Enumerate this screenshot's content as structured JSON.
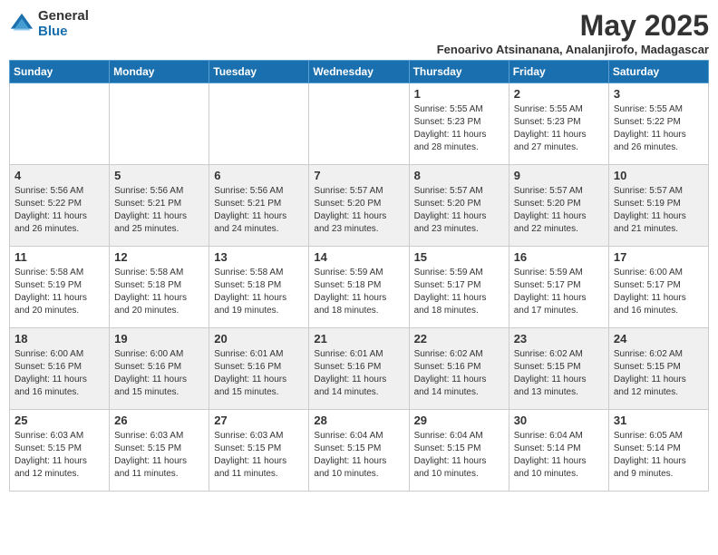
{
  "header": {
    "logo_general": "General",
    "logo_blue": "Blue",
    "month_title": "May 2025",
    "location": "Fenoarivo Atsinanana, Analanjirofo, Madagascar"
  },
  "days_of_week": [
    "Sunday",
    "Monday",
    "Tuesday",
    "Wednesday",
    "Thursday",
    "Friday",
    "Saturday"
  ],
  "weeks": [
    [
      {
        "day": "",
        "info": ""
      },
      {
        "day": "",
        "info": ""
      },
      {
        "day": "",
        "info": ""
      },
      {
        "day": "",
        "info": ""
      },
      {
        "day": "1",
        "info": "Sunrise: 5:55 AM\nSunset: 5:23 PM\nDaylight: 11 hours\nand 28 minutes."
      },
      {
        "day": "2",
        "info": "Sunrise: 5:55 AM\nSunset: 5:23 PM\nDaylight: 11 hours\nand 27 minutes."
      },
      {
        "day": "3",
        "info": "Sunrise: 5:55 AM\nSunset: 5:22 PM\nDaylight: 11 hours\nand 26 minutes."
      }
    ],
    [
      {
        "day": "4",
        "info": "Sunrise: 5:56 AM\nSunset: 5:22 PM\nDaylight: 11 hours\nand 26 minutes."
      },
      {
        "day": "5",
        "info": "Sunrise: 5:56 AM\nSunset: 5:21 PM\nDaylight: 11 hours\nand 25 minutes."
      },
      {
        "day": "6",
        "info": "Sunrise: 5:56 AM\nSunset: 5:21 PM\nDaylight: 11 hours\nand 24 minutes."
      },
      {
        "day": "7",
        "info": "Sunrise: 5:57 AM\nSunset: 5:20 PM\nDaylight: 11 hours\nand 23 minutes."
      },
      {
        "day": "8",
        "info": "Sunrise: 5:57 AM\nSunset: 5:20 PM\nDaylight: 11 hours\nand 23 minutes."
      },
      {
        "day": "9",
        "info": "Sunrise: 5:57 AM\nSunset: 5:20 PM\nDaylight: 11 hours\nand 22 minutes."
      },
      {
        "day": "10",
        "info": "Sunrise: 5:57 AM\nSunset: 5:19 PM\nDaylight: 11 hours\nand 21 minutes."
      }
    ],
    [
      {
        "day": "11",
        "info": "Sunrise: 5:58 AM\nSunset: 5:19 PM\nDaylight: 11 hours\nand 20 minutes."
      },
      {
        "day": "12",
        "info": "Sunrise: 5:58 AM\nSunset: 5:18 PM\nDaylight: 11 hours\nand 20 minutes."
      },
      {
        "day": "13",
        "info": "Sunrise: 5:58 AM\nSunset: 5:18 PM\nDaylight: 11 hours\nand 19 minutes."
      },
      {
        "day": "14",
        "info": "Sunrise: 5:59 AM\nSunset: 5:18 PM\nDaylight: 11 hours\nand 18 minutes."
      },
      {
        "day": "15",
        "info": "Sunrise: 5:59 AM\nSunset: 5:17 PM\nDaylight: 11 hours\nand 18 minutes."
      },
      {
        "day": "16",
        "info": "Sunrise: 5:59 AM\nSunset: 5:17 PM\nDaylight: 11 hours\nand 17 minutes."
      },
      {
        "day": "17",
        "info": "Sunrise: 6:00 AM\nSunset: 5:17 PM\nDaylight: 11 hours\nand 16 minutes."
      }
    ],
    [
      {
        "day": "18",
        "info": "Sunrise: 6:00 AM\nSunset: 5:16 PM\nDaylight: 11 hours\nand 16 minutes."
      },
      {
        "day": "19",
        "info": "Sunrise: 6:00 AM\nSunset: 5:16 PM\nDaylight: 11 hours\nand 15 minutes."
      },
      {
        "day": "20",
        "info": "Sunrise: 6:01 AM\nSunset: 5:16 PM\nDaylight: 11 hours\nand 15 minutes."
      },
      {
        "day": "21",
        "info": "Sunrise: 6:01 AM\nSunset: 5:16 PM\nDaylight: 11 hours\nand 14 minutes."
      },
      {
        "day": "22",
        "info": "Sunrise: 6:02 AM\nSunset: 5:16 PM\nDaylight: 11 hours\nand 14 minutes."
      },
      {
        "day": "23",
        "info": "Sunrise: 6:02 AM\nSunset: 5:15 PM\nDaylight: 11 hours\nand 13 minutes."
      },
      {
        "day": "24",
        "info": "Sunrise: 6:02 AM\nSunset: 5:15 PM\nDaylight: 11 hours\nand 12 minutes."
      }
    ],
    [
      {
        "day": "25",
        "info": "Sunrise: 6:03 AM\nSunset: 5:15 PM\nDaylight: 11 hours\nand 12 minutes."
      },
      {
        "day": "26",
        "info": "Sunrise: 6:03 AM\nSunset: 5:15 PM\nDaylight: 11 hours\nand 11 minutes."
      },
      {
        "day": "27",
        "info": "Sunrise: 6:03 AM\nSunset: 5:15 PM\nDaylight: 11 hours\nand 11 minutes."
      },
      {
        "day": "28",
        "info": "Sunrise: 6:04 AM\nSunset: 5:15 PM\nDaylight: 11 hours\nand 10 minutes."
      },
      {
        "day": "29",
        "info": "Sunrise: 6:04 AM\nSunset: 5:15 PM\nDaylight: 11 hours\nand 10 minutes."
      },
      {
        "day": "30",
        "info": "Sunrise: 6:04 AM\nSunset: 5:14 PM\nDaylight: 11 hours\nand 10 minutes."
      },
      {
        "day": "31",
        "info": "Sunrise: 6:05 AM\nSunset: 5:14 PM\nDaylight: 11 hours\nand 9 minutes."
      }
    ]
  ]
}
